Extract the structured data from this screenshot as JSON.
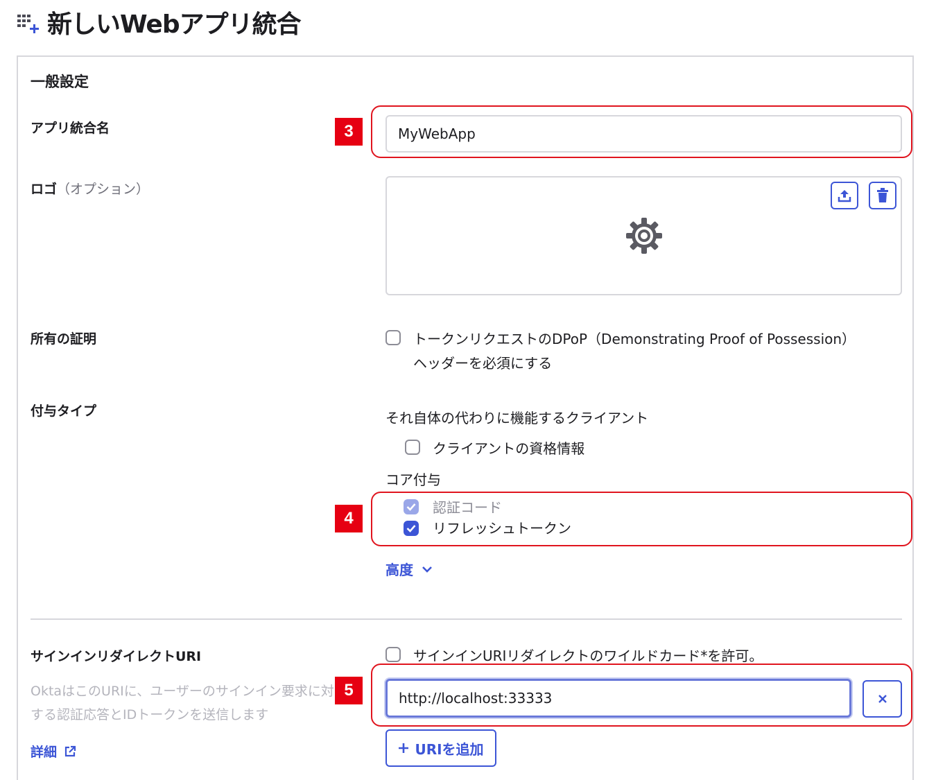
{
  "page": {
    "title": "新しいWebアプリ統合"
  },
  "general": {
    "section_title": "一般設定",
    "app_name_label": "アプリ統合名",
    "app_name_value": "MyWebApp",
    "logo_label": "ロゴ",
    "logo_optional": "（オプション）"
  },
  "proof": {
    "label": "所有の証明",
    "dpop_line1": "トークンリクエストのDPoP（Demonstrating Proof of Possession）",
    "dpop_line2": "ヘッダーを必須にする",
    "dpop_checked": false
  },
  "grants": {
    "label": "付与タイプ",
    "client_acting_heading": "それ自体の代わりに機能するクライアント",
    "client_credentials": "クライアントの資格情報",
    "core_heading": "コア付与",
    "authorization_code": "認証コード",
    "refresh_token": "リフレッシュトークン",
    "advanced": "高度"
  },
  "redirect": {
    "label": "サインインリダイレクトURI",
    "helper": "OktaはこのURIに、ユーザーのサインイン要求に対する認証応答とIDトークンを送信します",
    "details_link": "詳細",
    "wildcard_label": "サインインURIリダイレクトのワイルドカード*を許可。",
    "uri_value": "http://localhost:33333",
    "add_uri": "URIを追加"
  },
  "annotations": {
    "badge3": "3",
    "badge4": "4",
    "badge5": "5"
  },
  "colors": {
    "accent": "#3c55d6",
    "highlight": "#e0141e",
    "badge": "#e60012"
  }
}
